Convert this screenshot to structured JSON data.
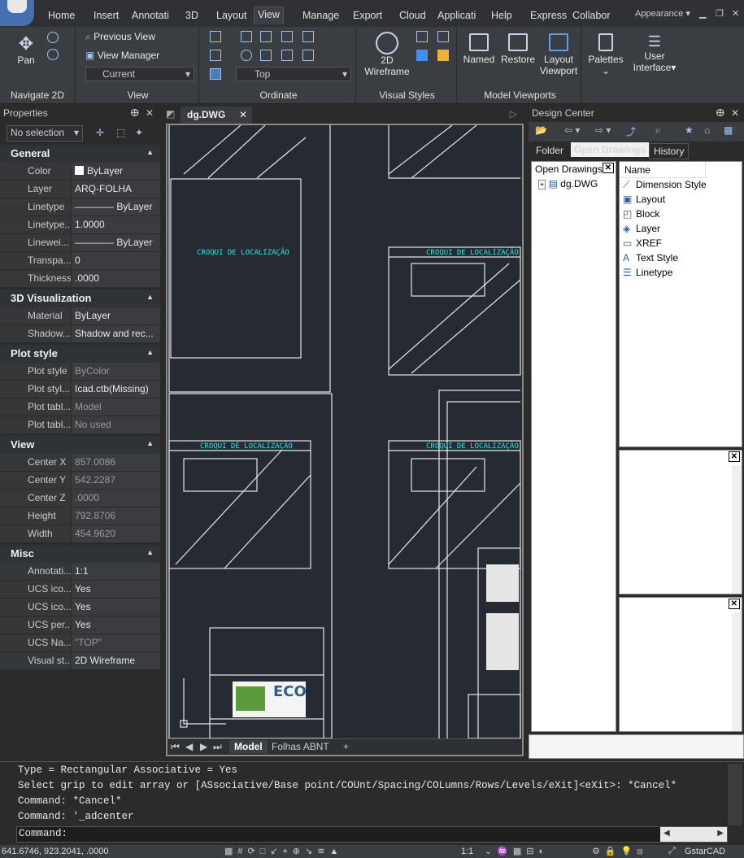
{
  "tabs": [
    "Home",
    "Insert",
    "Annotati",
    "3D",
    "Layout",
    "View",
    "Manage",
    "Export",
    "Cloud",
    "Applicati",
    "Help",
    "Express",
    "Collabor"
  ],
  "appearance": "Appearance",
  "ribbon": {
    "navigate": {
      "pan": "Pan",
      "title": "Navigate 2D"
    },
    "view": {
      "previous": "Previous View",
      "manager": "View Manager",
      "current": "Current",
      "title": "View"
    },
    "ordinate": {
      "top": "Top",
      "title": "Ordinate"
    },
    "visual": {
      "wireframe_1": "2D",
      "wireframe_2": "Wireframe",
      "title": "Visual Styles"
    },
    "viewports": {
      "named": "Named",
      "restore": "Restore",
      "layout_1": "Layout",
      "layout_2": "Viewport",
      "title": "Model Viewports"
    },
    "palettes": "Palettes",
    "ui_1": "User",
    "ui_2": "Interface"
  },
  "properties": {
    "title": "Properties",
    "selection": "No selection",
    "sections": [
      {
        "name": "General",
        "rows": [
          [
            "Color",
            "ByLayer"
          ],
          [
            "Layer",
            "ARQ-FOLHA"
          ],
          [
            "Linetype",
            "———— ByLayer"
          ],
          [
            "Linetype...",
            "1.0000"
          ],
          [
            "Linewei...",
            "———— ByLayer"
          ],
          [
            "Transpa...",
            "0"
          ],
          [
            "Thickness",
            ".0000"
          ]
        ]
      },
      {
        "name": "3D Visualization",
        "rows": [
          [
            "Material",
            "ByLayer"
          ],
          [
            "Shadow...",
            "Shadow and rec..."
          ]
        ]
      },
      {
        "name": "Plot style",
        "rows": [
          [
            "Plot style",
            "ByColor"
          ],
          [
            "Plot styl...",
            "Icad.ctb(Missing)"
          ],
          [
            "Plot tabl...",
            "Model"
          ],
          [
            "Plot tabl...",
            "No used"
          ]
        ]
      },
      {
        "name": "View",
        "rows": [
          [
            "Center X",
            "857.0086"
          ],
          [
            "Center Y",
            "542.2287"
          ],
          [
            "Center Z",
            ".0000"
          ],
          [
            "Height",
            "792.8706"
          ],
          [
            "Width",
            "454.9620"
          ]
        ]
      },
      {
        "name": "Misc",
        "rows": [
          [
            "Annotati...",
            "1:1"
          ],
          [
            "UCS ico...",
            "Yes"
          ],
          [
            "UCS ico...",
            "Yes"
          ],
          [
            "UCS per...",
            "Yes"
          ],
          [
            "UCS Na...",
            "\"TOP\""
          ],
          [
            "Visual st...",
            "2D Wireframe"
          ]
        ]
      }
    ]
  },
  "drawing": {
    "tab": "dg.DWG",
    "layouts": [
      "Model",
      "Folhas ABNT"
    ],
    "croqui": "CROQUI DE LOCALIZAÇÃO",
    "eco": "ECO"
  },
  "design_center": {
    "title": "Design Center",
    "tabs": [
      "Folder",
      "Open Drawings",
      "History"
    ],
    "tree_header": "Open Drawings",
    "tree_item": "dg.DWG",
    "list_header": "Name",
    "items": [
      "Dimension Style",
      "Layout",
      "Block",
      "Layer",
      "XREF",
      "Text Style",
      "Linetype"
    ]
  },
  "command": {
    "lines": [
      "Type = Rectangular  Associative = Yes",
      "Select grip to edit array or [ASsociative/Base point/COUnt/Spacing/COLumns/Rows/Levels/eXit]<eXit>: *Cancel*",
      "Command: *Cancel*",
      "Command: '_adcenter"
    ],
    "prompt": "Command:"
  },
  "status": {
    "coords": "641.6746, 923.2041, .0000",
    "scale": "1:1",
    "app": "GstarCAD"
  }
}
